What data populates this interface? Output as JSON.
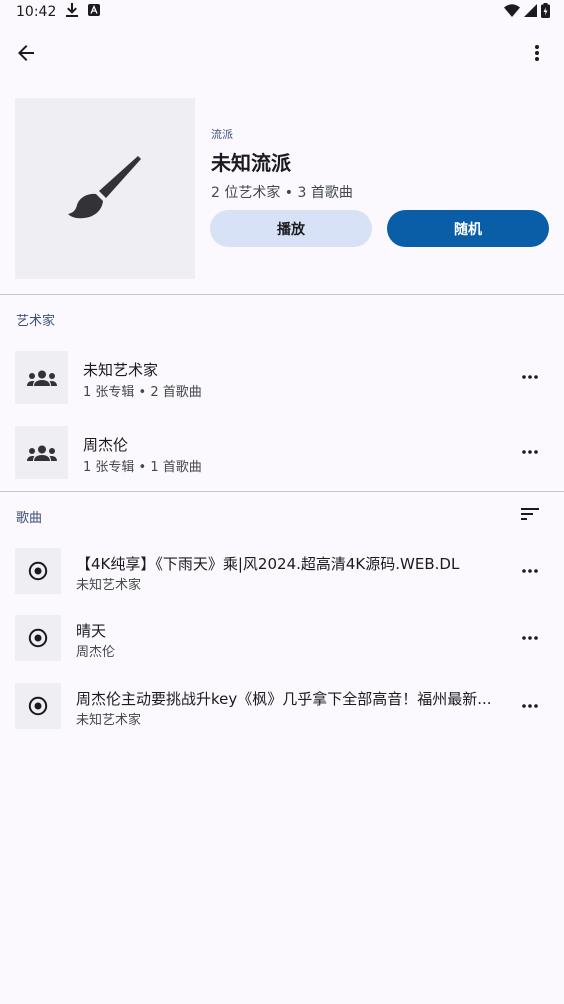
{
  "status_bar": {
    "time": "10:42"
  },
  "genre": {
    "caption": "流派",
    "title": "未知流派",
    "meta": "2 位艺术家 • 3 首歌曲"
  },
  "actions": {
    "play": "播放",
    "shuffle": "随机"
  },
  "artists_section": {
    "title": "艺术家",
    "items": [
      {
        "name": "未知艺术家",
        "meta": "1 张专辑 • 2 首歌曲"
      },
      {
        "name": "周杰伦",
        "meta": "1 张专辑 • 1 首歌曲"
      }
    ]
  },
  "songs_section": {
    "title": "歌曲",
    "items": [
      {
        "title": "【4K纯享】《下雨天》乘|风2024.超高清4K源码.WEB.DL",
        "artist": "未知艺术家"
      },
      {
        "title": "晴天",
        "artist": "周杰伦"
      },
      {
        "title": "周杰伦主动要挑战升key《枫》几乎拿下全部高音！福州最新...",
        "artist": "未知艺术家"
      }
    ]
  }
}
